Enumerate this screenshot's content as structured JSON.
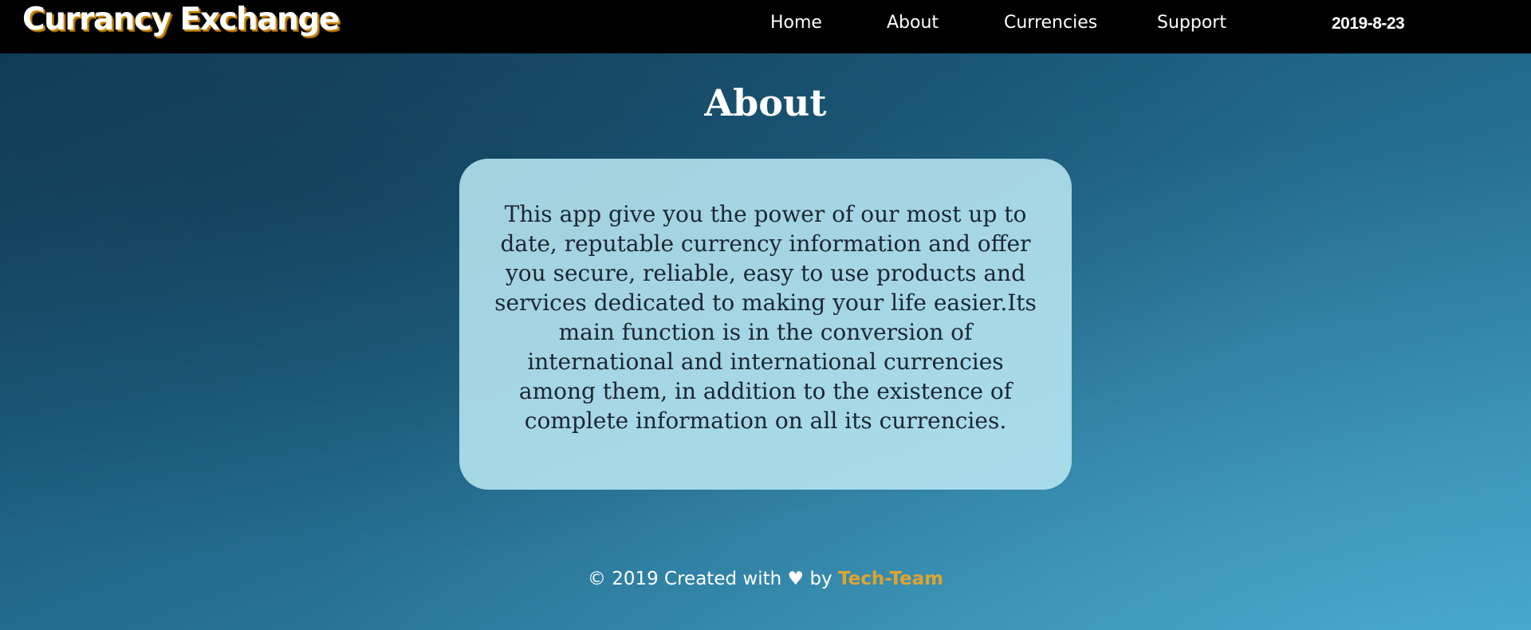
{
  "header": {
    "brand": "Currancy Exchange",
    "nav": {
      "home": "Home",
      "about": "About",
      "currencies": "Currencies",
      "support": "Support"
    },
    "date": "2019-8-23"
  },
  "main": {
    "title": "About",
    "description": "This app give you the power of our most up to date, reputable currency information and offer you secure, reliable, easy to use products and services dedicated to making your life easier.Its main function is in the conversion of international and international currencies among them, in addition to the existence of complete information on all its currencies."
  },
  "footer": {
    "prefix": "© 2019 Created with",
    "heart_icon": "♥",
    "by": "by",
    "credit": "Tech-Team"
  },
  "colors": {
    "navbar": "#000000",
    "brand_shadow": "#c8860a",
    "card": "#bce9f3",
    "credit": "#e0a42e"
  }
}
